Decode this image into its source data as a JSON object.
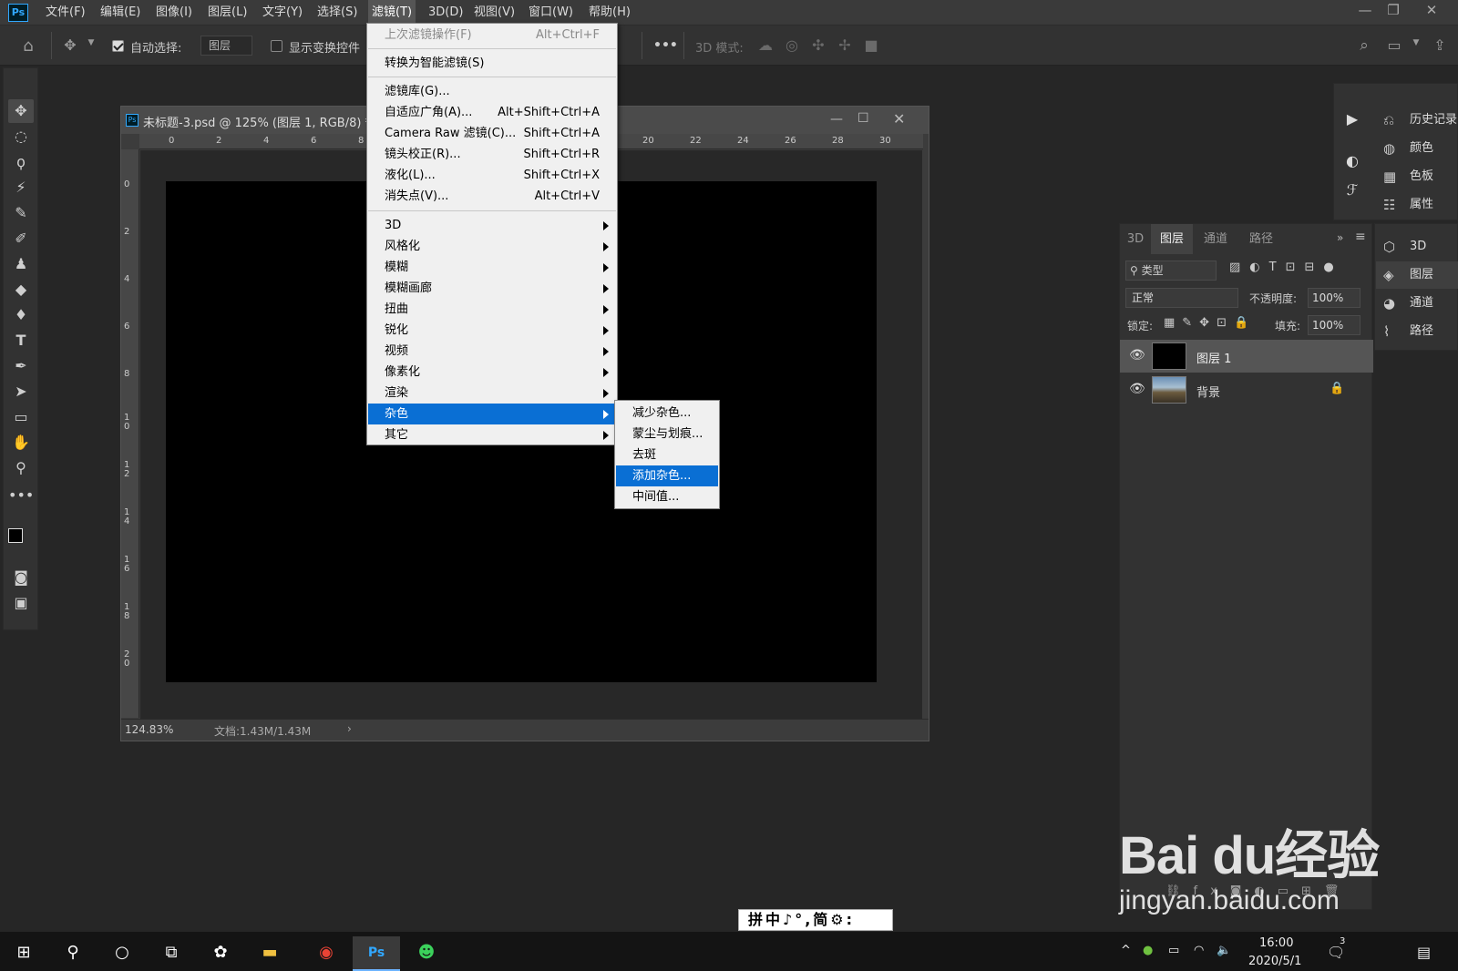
{
  "app": {
    "logo": "Ps"
  },
  "menubar": {
    "items": [
      "文件(F)",
      "编辑(E)",
      "图像(I)",
      "图层(L)",
      "文字(Y)",
      "选择(S)",
      "滤镜(T)",
      "3D(D)",
      "视图(V)",
      "窗口(W)",
      "帮助(H)"
    ],
    "active": "滤镜(T)"
  },
  "options": {
    "auto_select_label": "自动选择:",
    "auto_select_value": "图层",
    "show_transform_label": "显示变换控件",
    "mode_3d_label": "3D 模式:",
    "more": "•••"
  },
  "document": {
    "title": "未标题-3.psd @ 125% (图层 1, RGB/8) *",
    "zoom": "124.83%",
    "doc_info": "文档:1.43M/1.43M",
    "ruler_h": [
      "0",
      "2",
      "4",
      "6",
      "8",
      "20",
      "22",
      "24",
      "26",
      "28",
      "30"
    ],
    "ruler_v": [
      "0",
      "2",
      "4",
      "6",
      "8",
      "1\n0",
      "1\n2",
      "1\n4",
      "1\n6",
      "1\n8",
      "2\n0"
    ]
  },
  "filter_menu": {
    "items": [
      {
        "label": "上次滤镜操作(F)",
        "shortcut": "Alt+Ctrl+F",
        "disabled": true
      },
      {
        "label": "转换为智能滤镜(S)",
        "shortcut": ""
      },
      {
        "label": "滤镜库(G)...",
        "shortcut": ""
      },
      {
        "label": "自适应广角(A)...",
        "shortcut": "Alt+Shift+Ctrl+A"
      },
      {
        "label": "Camera Raw 滤镜(C)...",
        "shortcut": "Shift+Ctrl+A"
      },
      {
        "label": "镜头校正(R)...",
        "shortcut": "Shift+Ctrl+R"
      },
      {
        "label": "液化(L)...",
        "shortcut": "Shift+Ctrl+X"
      },
      {
        "label": "消失点(V)...",
        "shortcut": "Alt+Ctrl+V"
      },
      {
        "label": "3D",
        "submenu": true
      },
      {
        "label": "风格化",
        "submenu": true
      },
      {
        "label": "模糊",
        "submenu": true
      },
      {
        "label": "模糊画廊",
        "submenu": true
      },
      {
        "label": "扭曲",
        "submenu": true
      },
      {
        "label": "锐化",
        "submenu": true
      },
      {
        "label": "视频",
        "submenu": true
      },
      {
        "label": "像素化",
        "submenu": true
      },
      {
        "label": "渲染",
        "submenu": true
      },
      {
        "label": "杂色",
        "submenu": true,
        "highlighted": true
      },
      {
        "label": "其它",
        "submenu": true
      }
    ]
  },
  "noise_submenu": {
    "items": [
      {
        "label": "减少杂色..."
      },
      {
        "label": "蒙尘与划痕..."
      },
      {
        "label": "去斑"
      },
      {
        "label": "添加杂色...",
        "highlighted": true
      },
      {
        "label": "中间值..."
      }
    ]
  },
  "right_panels": {
    "items": [
      {
        "icon": "history-icon",
        "label": "历史记录"
      },
      {
        "icon": "color-icon",
        "label": "颜色"
      },
      {
        "icon": "swatches-icon",
        "label": "色板"
      },
      {
        "icon": "properties-icon",
        "label": "属性"
      },
      {
        "icon": "cube-icon",
        "label": "3D"
      },
      {
        "icon": "layers-icon",
        "label": "图层"
      },
      {
        "icon": "channels-icon",
        "label": "通道"
      },
      {
        "icon": "paths-icon",
        "label": "路径"
      }
    ]
  },
  "layers_panel": {
    "tabs": [
      "3D",
      "图层",
      "通道",
      "路径"
    ],
    "active_tab": "图层",
    "filter_kind": "类型",
    "blend_mode": "正常",
    "opacity_label": "不透明度:",
    "opacity_value": "100%",
    "lock_label": "锁定:",
    "fill_label": "填充:",
    "fill_value": "100%",
    "layers": [
      {
        "name": "图层 1",
        "selected": true
      },
      {
        "name": "背景",
        "locked": true
      }
    ]
  },
  "ime": {
    "text": "拼中♪°,简⚙:"
  },
  "taskbar": {
    "time": "16:00",
    "date": "2020/5/1",
    "notification_count": "3"
  },
  "watermark": {
    "brand": "Bai du经验",
    "url": "jingyan.baidu.com"
  },
  "colors": {
    "menu_highlight": "#0a6fd4",
    "ps_blue": "#31a8ff"
  }
}
